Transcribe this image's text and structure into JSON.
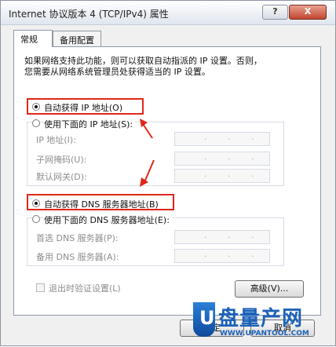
{
  "dialog": {
    "title": "Internet 协议版本 4 (TCP/IPv4) 属性",
    "help": "?",
    "close": "X"
  },
  "tabs": [
    "常规",
    "备用配置"
  ],
  "description_line1": "如果网络支持此功能，则可以获取自动指派的 IP 设置。否则，",
  "description_line2": "您需要从网络系统管理员处获得适当的 IP 设置。",
  "ip": {
    "auto": "自动获得 IP 地址(O)",
    "manual": "使用下面的 IP 地址(S):",
    "address_label": "IP 地址(I):",
    "mask_label": "子网掩码(U):",
    "gateway_label": "默认网关(D):"
  },
  "dns": {
    "auto": "自动获得 DNS 服务器地址(B)",
    "manual": "使用下面的 DNS 服务器地址(E):",
    "preferred_label": "首选 DNS 服务器(P):",
    "alternate_label": "备用 DNS 服务器(A):"
  },
  "validate": "退出时验证设置(L)",
  "advanced": "高级(V)...",
  "ok": "确定",
  "cancel": "取消",
  "watermark": {
    "letter": "U",
    "cn": "盘量产网",
    "url": "WWW.UPANTOOL.COM"
  },
  "colors": {
    "highlight": "#e0271a",
    "watermark": "#1c62b8"
  }
}
